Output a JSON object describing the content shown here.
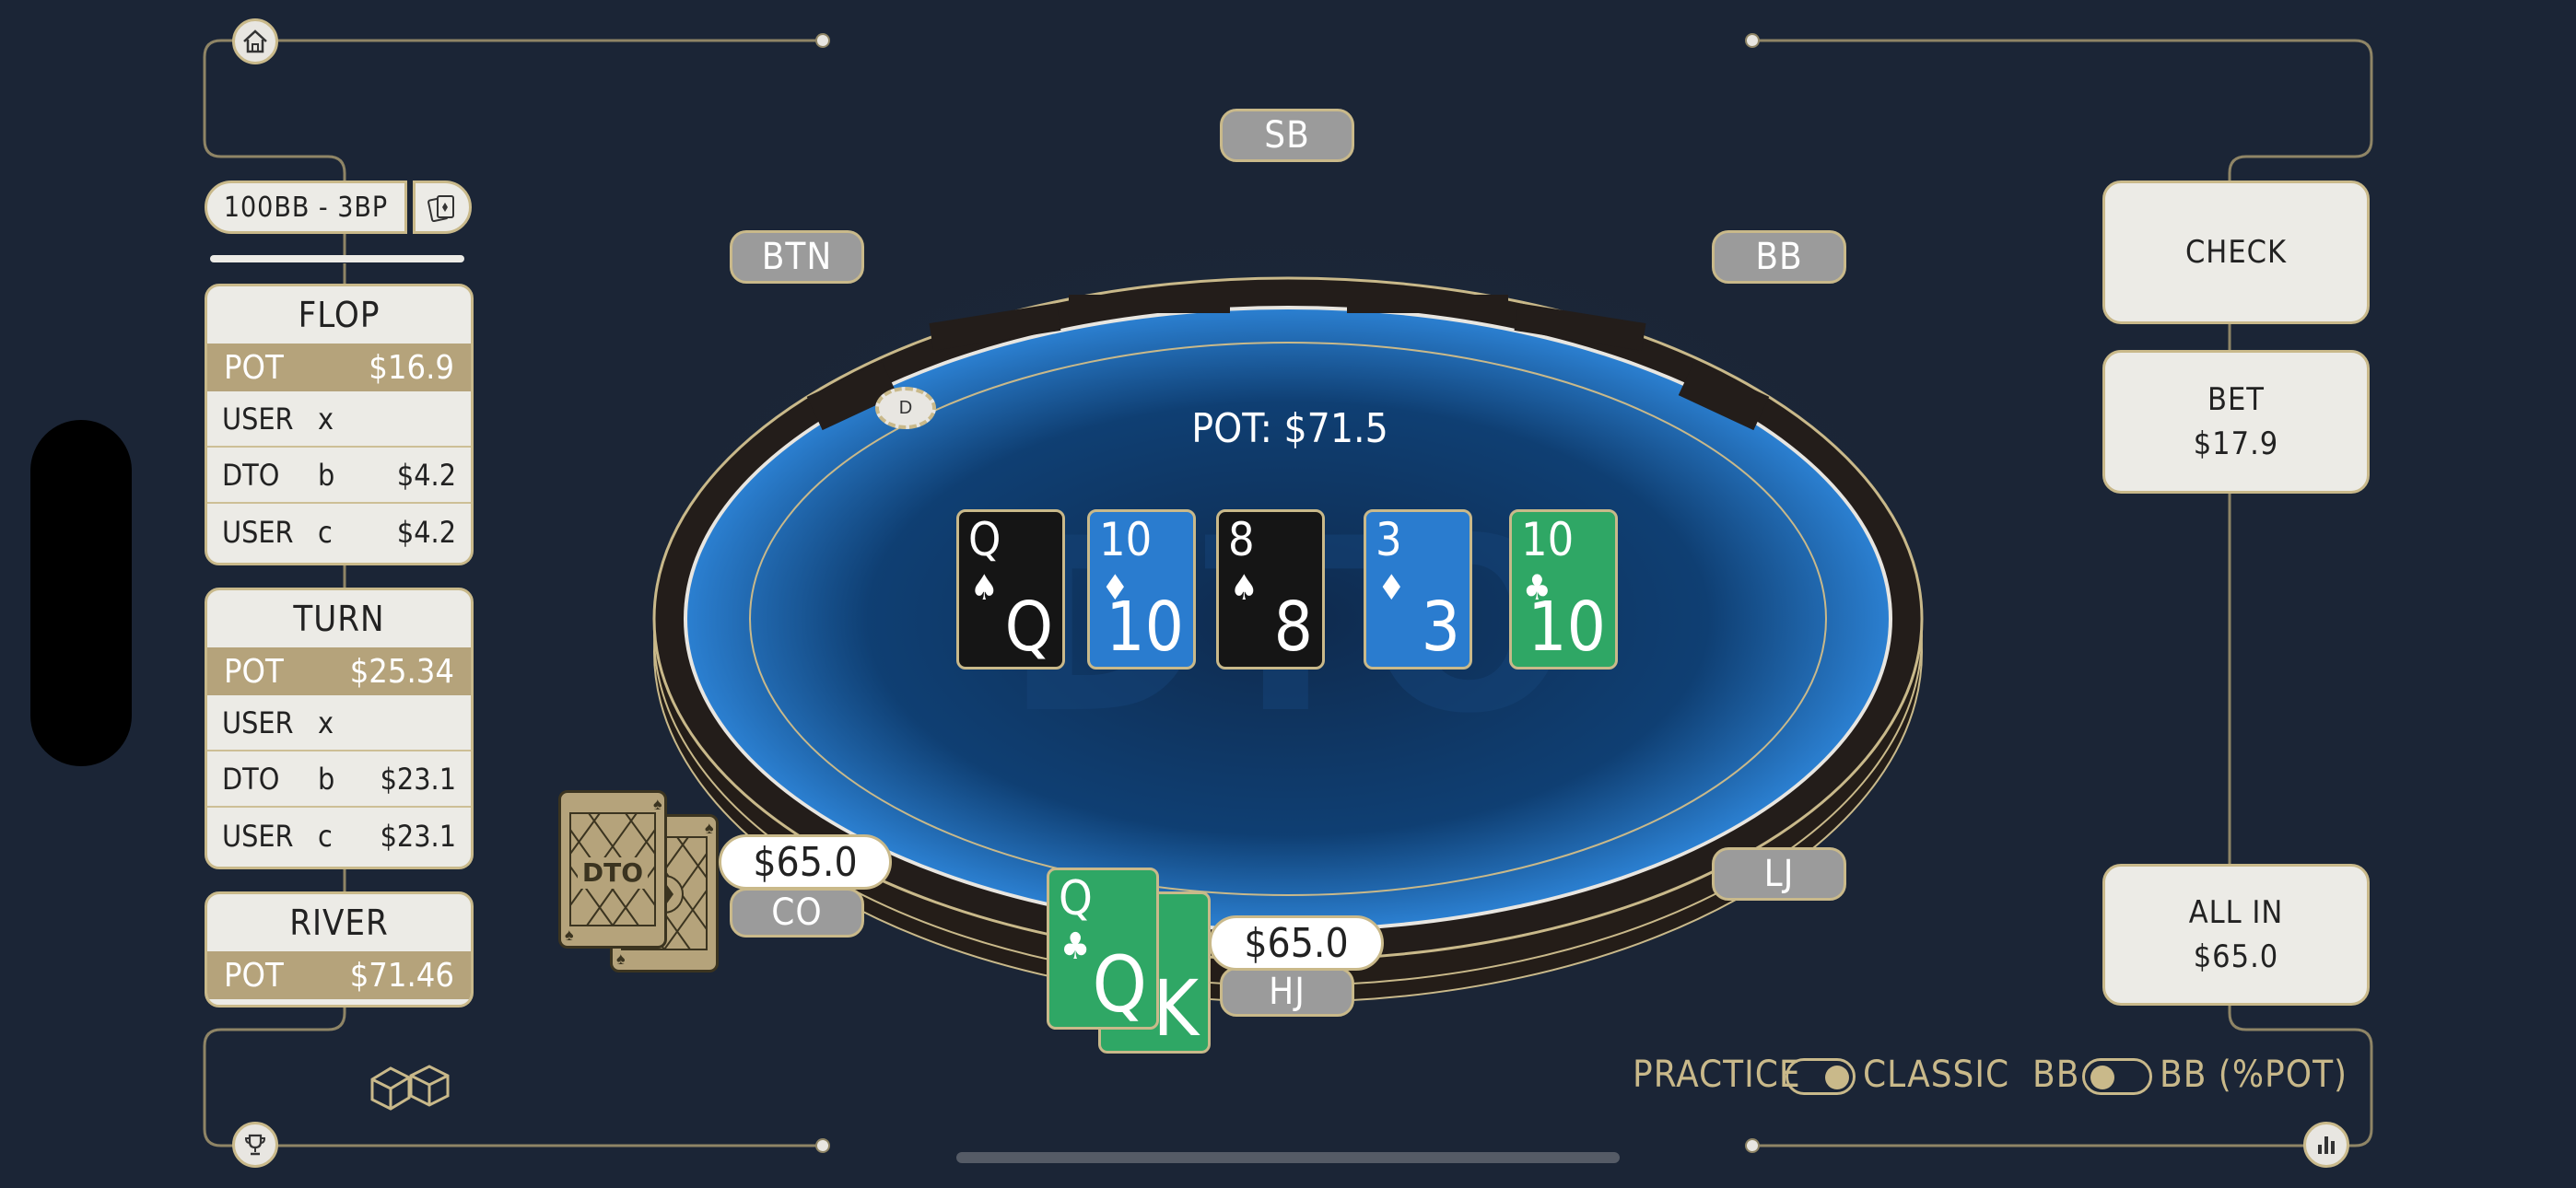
{
  "scenario": {
    "label": "100BB - 3BP"
  },
  "streets": [
    {
      "title": "FLOP",
      "pot_label": "POT",
      "pot": "$16.9",
      "actions": [
        {
          "who": "USER",
          "act": "x",
          "amt": ""
        },
        {
          "who": "DTO",
          "act": "b",
          "amt": "$4.2"
        },
        {
          "who": "USER",
          "act": "c",
          "amt": "$4.2"
        }
      ]
    },
    {
      "title": "TURN",
      "pot_label": "POT",
      "pot": "$25.34",
      "actions": [
        {
          "who": "USER",
          "act": "x",
          "amt": ""
        },
        {
          "who": "DTO",
          "act": "b",
          "amt": "$23.1"
        },
        {
          "who": "USER",
          "act": "c",
          "amt": "$23.1"
        }
      ]
    },
    {
      "title": "RIVER",
      "pot_label": "POT",
      "pot": "$71.46",
      "actions": []
    }
  ],
  "seats": {
    "sb": "SB",
    "btn": "BTN",
    "bb": "BB",
    "lj": "LJ",
    "co": "CO",
    "hj": "HJ"
  },
  "table": {
    "pot": "POT: $71.5",
    "dealer": "D",
    "watermark": "DTO"
  },
  "board": [
    {
      "rank": "Q",
      "suit": "♠",
      "color": "black"
    },
    {
      "rank": "10",
      "suit": "♦",
      "color": "blue"
    },
    {
      "rank": "8",
      "suit": "♠",
      "color": "black"
    },
    {
      "rank": "3",
      "suit": "♦",
      "color": "blue"
    },
    {
      "rank": "10",
      "suit": "♣",
      "color": "green"
    }
  ],
  "hero": {
    "card1_rank": "Q",
    "card1_suit": "♣",
    "card2_rank": "K",
    "stack": "$65.0"
  },
  "villain": {
    "stack": "$65.0",
    "back_logo": "DTO"
  },
  "actions": {
    "check": "CHECK",
    "bet_label": "BET",
    "bet_amount": "$17.9",
    "allin_label": "ALL IN",
    "allin_amount": "$65.0"
  },
  "toggles": {
    "practice": "PRACTICE",
    "classic": "CLASSIC",
    "bb": "BB",
    "bb_pot": "BB (%POT)"
  },
  "icons": {
    "home": "home-icon",
    "trophy": "trophy-icon",
    "stats": "bar-chart-icon",
    "dice": "dice-icon",
    "cards": "cards-icon"
  },
  "colors": {
    "background": "#1b2536",
    "gold": "#c9b98a",
    "felt": "#0f3f73",
    "card_blue": "#2a7ccf",
    "card_green": "#2fa765"
  }
}
